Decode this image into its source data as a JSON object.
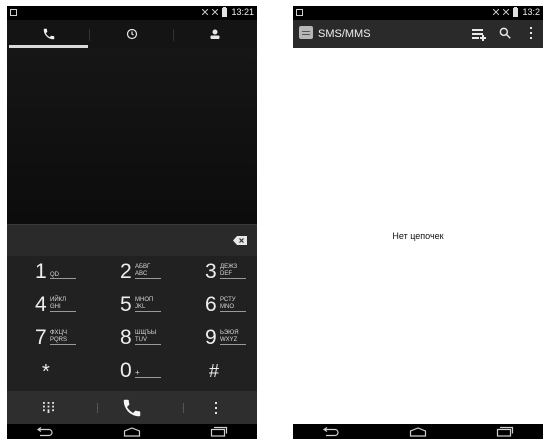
{
  "left": {
    "status_bar": {
      "time": "13:21"
    },
    "tabs": [
      {
        "icon": "phone-icon",
        "active": true
      },
      {
        "icon": "recent-clock-icon",
        "active": false
      },
      {
        "icon": "contacts-person-icon",
        "active": false
      }
    ],
    "keys": [
      {
        "num": "1",
        "sub": "QD"
      },
      {
        "num": "2",
        "sub": "АБВГ\nABC"
      },
      {
        "num": "3",
        "sub": "ДЕЖЗ\nDEF"
      },
      {
        "num": "4",
        "sub": "ИЙКЛ\nGHI"
      },
      {
        "num": "5",
        "sub": "МНОП\nJKL"
      },
      {
        "num": "6",
        "sub": "РСТУ\nMNO"
      },
      {
        "num": "7",
        "sub": "ФХЦЧ\nPQRS"
      },
      {
        "num": "8",
        "sub": "ШЩЪЫ\nTUV"
      },
      {
        "num": "9",
        "sub": "ЬЭЮЯ\nWXYZ"
      },
      {
        "num": "*",
        "sub": ""
      },
      {
        "num": "0",
        "sub": "+"
      },
      {
        "num": "#",
        "sub": ""
      }
    ]
  },
  "right": {
    "status_bar": {
      "time": "13:2"
    },
    "app_title": "SMS/MMS",
    "empty_message": "Нет цепочек"
  },
  "colors": {
    "dialer_bg": "#212121",
    "accent_line": "#d9d9d9",
    "actionbar": "#2a2a2a"
  }
}
